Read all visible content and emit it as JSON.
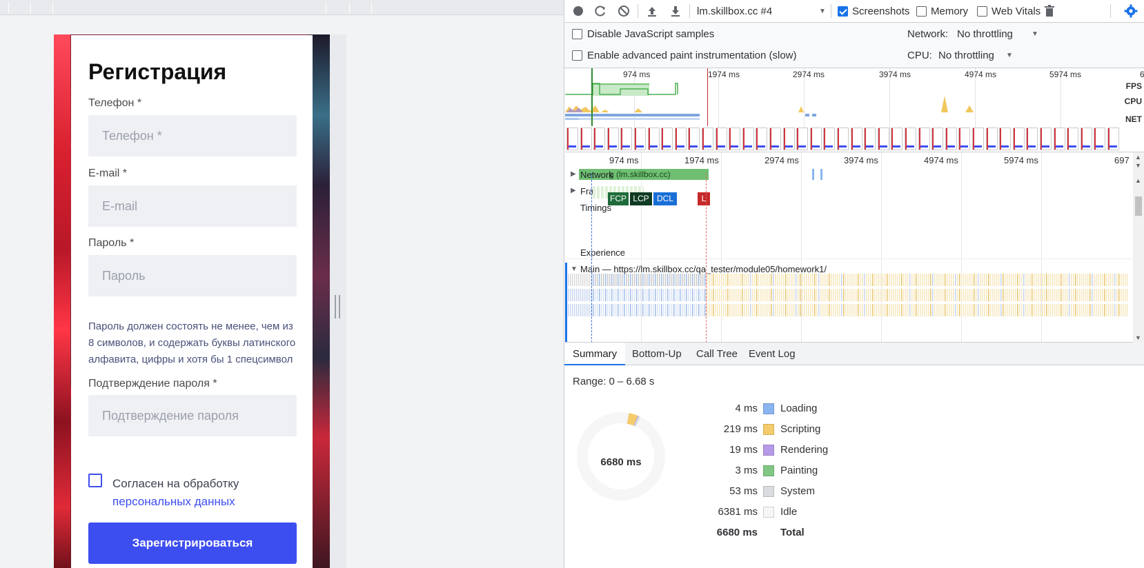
{
  "page": {
    "title": "Регистрация",
    "fields": [
      {
        "label": "Телефон *",
        "placeholder": "Телефон *"
      },
      {
        "label": "E-mail *",
        "placeholder": "E-mail"
      },
      {
        "label": "Пароль *",
        "placeholder": "Пароль"
      },
      {
        "label": "Подтверждение пароля *",
        "placeholder": "Подтверждение пароля"
      }
    ],
    "password_hint": "Пароль должен состоять не менее, чем из 8 символов, и содержать буквы латинского алфавита, цифры и хотя бы 1 спецсимвол",
    "agree_text": "Согласен на обработку",
    "agree_link": "персональных данных",
    "submit_label": "Зарегистрироваться"
  },
  "devtools": {
    "toolbar": {
      "profile_select": "lm.skillbox.cc #4",
      "screenshots_label": "Screenshots",
      "screenshots_checked": true,
      "memory_label": "Memory",
      "memory_checked": false,
      "webvitals_label": "Web Vitals",
      "webvitals_checked": false
    },
    "settings": {
      "disable_js_samples": "Disable JavaScript samples",
      "enable_paint": "Enable advanced paint instrumentation (slow)",
      "network_label": "Network:",
      "network_value": "No throttling",
      "cpu_label": "CPU:",
      "cpu_value": "No throttling"
    },
    "overview": {
      "ticks": [
        "974 ms",
        "1974 ms",
        "2974 ms",
        "3974 ms",
        "4974 ms",
        "5974 ms",
        "6"
      ],
      "labels": [
        "FPS",
        "CPU",
        "NET"
      ]
    },
    "flamechart": {
      "ticks": [
        "974 ms",
        "1974 ms",
        "2974 ms",
        "3974 ms",
        "4974 ms",
        "5974 ms",
        "697"
      ],
      "tracks": {
        "network": "Network",
        "network_bar": "g (lm.skillbox.cc)",
        "frames": "Frames",
        "timings": "Timings",
        "experience": "Experience",
        "main": "Main — https://lm.skillbox.cc/qa_tester/module05/homework1/"
      },
      "markers": [
        "FCP",
        "LCP",
        "DCL",
        "L"
      ]
    },
    "tabs": [
      "Summary",
      "Bottom-Up",
      "Call Tree",
      "Event Log"
    ],
    "active_tab": "Summary",
    "summary": {
      "range": "Range: 0 – 6.68 s",
      "total_center": "6680 ms",
      "rows": [
        {
          "value": "4 ms",
          "name": "Loading",
          "color": "#8ab4f0",
          "ms": 4
        },
        {
          "value": "219 ms",
          "name": "Scripting",
          "color": "#f5cc6b",
          "ms": 219
        },
        {
          "value": "19 ms",
          "name": "Rendering",
          "color": "#b69ae8",
          "ms": 19
        },
        {
          "value": "3 ms",
          "name": "Painting",
          "color": "#81c784",
          "ms": 3
        },
        {
          "value": "53 ms",
          "name": "System",
          "color": "#dadce0",
          "ms": 53
        },
        {
          "value": "6381 ms",
          "name": "Idle",
          "color": "#f6f6f6",
          "ms": 6381
        }
      ],
      "total_value": "6680 ms",
      "total_label": "Total"
    }
  }
}
